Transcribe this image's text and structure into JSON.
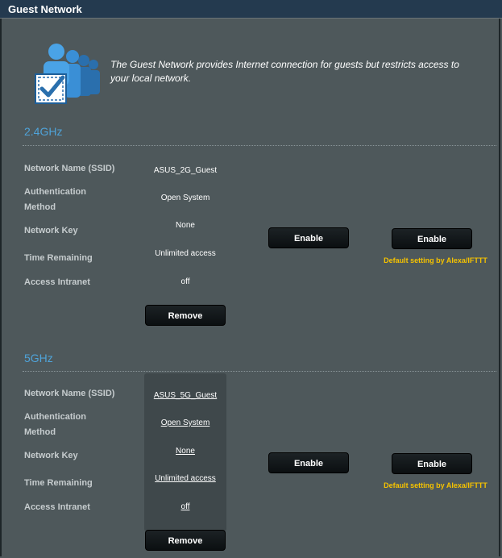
{
  "page": {
    "title": "Guest Network"
  },
  "intro": {
    "text_line1": "The Guest Network provides Internet connection for guests but restricts access to",
    "text_line2": "your local network."
  },
  "labels": {
    "ssid": "Network Name (SSID)",
    "auth_line1": "Authentication",
    "auth_line2": "Method",
    "key": "Network Key",
    "time": "Time Remaining",
    "intranet": "Access Intranet"
  },
  "band_24": {
    "title": "2.4GHz",
    "ssid": "ASUS_2G_Guest",
    "auth": "Open System",
    "key": "None",
    "time": "Unlimited access",
    "intranet": "off",
    "remove_label": "Remove",
    "enable1_label": "Enable",
    "enable2_label": "Enable",
    "note": "Default setting by Alexa/IFTTT"
  },
  "band_5": {
    "title": "5GHz",
    "ssid": "ASUS_5G_Guest",
    "auth": "Open System",
    "key": "None",
    "time": "Unlimited access",
    "intranet": "off",
    "remove_label": "Remove",
    "enable1_label": "Enable",
    "enable2_label": "Enable",
    "note": "Default setting by Alexa/IFTTT"
  },
  "colors": {
    "accent": "#4fa3d9",
    "note": "#f5c200",
    "background": "#4e585b"
  },
  "icons": {
    "intro": "guest-users-icon"
  }
}
